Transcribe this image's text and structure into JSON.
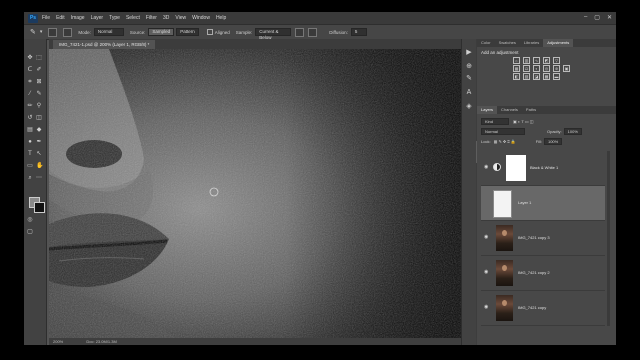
{
  "menubar": {
    "logo": "Ps",
    "items": [
      "File",
      "Edit",
      "Image",
      "Layer",
      "Type",
      "Select",
      "Filter",
      "3D",
      "View",
      "Window",
      "Help"
    ],
    "controls": [
      "–",
      "▢",
      "✕"
    ]
  },
  "options": {
    "mode_label": "Mode:",
    "mode_value": "Normal",
    "source_label": "Source:",
    "source_sampled": "Sampled",
    "source_pattern": "Pattern",
    "aligned_label": "Aligned",
    "sample_label": "Sample:",
    "sample_value": "Current & Below",
    "diffusion_label": "Diffusion:",
    "diffusion_value": "5"
  },
  "document": {
    "tab_title": "IMG_7421-1.psd @ 200% (Layer 1, RGB/8) *",
    "zoom": "200%",
    "doc_size": "Doc: 23.0M/1.3M"
  },
  "panels": {
    "top_tabs": [
      "Color",
      "Swatches",
      "Libraries",
      "Adjustments"
    ],
    "top_active_index": 3,
    "adjustments_title": "Add an adjustment",
    "layer_tabs": [
      "Layers",
      "Channels",
      "Paths"
    ],
    "layer_active_index": 0,
    "kind_label": "Kind",
    "blend_mode": "Normal",
    "opacity_label": "Opacity:",
    "opacity_value": "100%",
    "lock_label": "Lock:",
    "fill_label": "Fill:",
    "fill_value": "100%"
  },
  "layers": [
    {
      "name": "Black & White 1",
      "kind": "adjustment",
      "selected": false
    },
    {
      "name": "Layer 1",
      "kind": "white",
      "selected": true
    },
    {
      "name": "IMG_7421 copy 3",
      "kind": "photo",
      "selected": false
    },
    {
      "name": "IMG_7421 copy 2",
      "kind": "photo",
      "selected": false
    },
    {
      "name": "IMG_7421 copy",
      "kind": "photo",
      "selected": false
    }
  ],
  "layer_footer_icons": [
    "link-icon",
    "fx-icon",
    "mask-icon",
    "adjustment-icon",
    "group-icon",
    "new-layer-icon",
    "trash-icon"
  ],
  "colors": {
    "app_bg": "#535353",
    "panel_bg": "#484848",
    "menubar_bg": "#3a3a3a",
    "selected_layer": "#686868",
    "accent": "#31a8ff"
  }
}
